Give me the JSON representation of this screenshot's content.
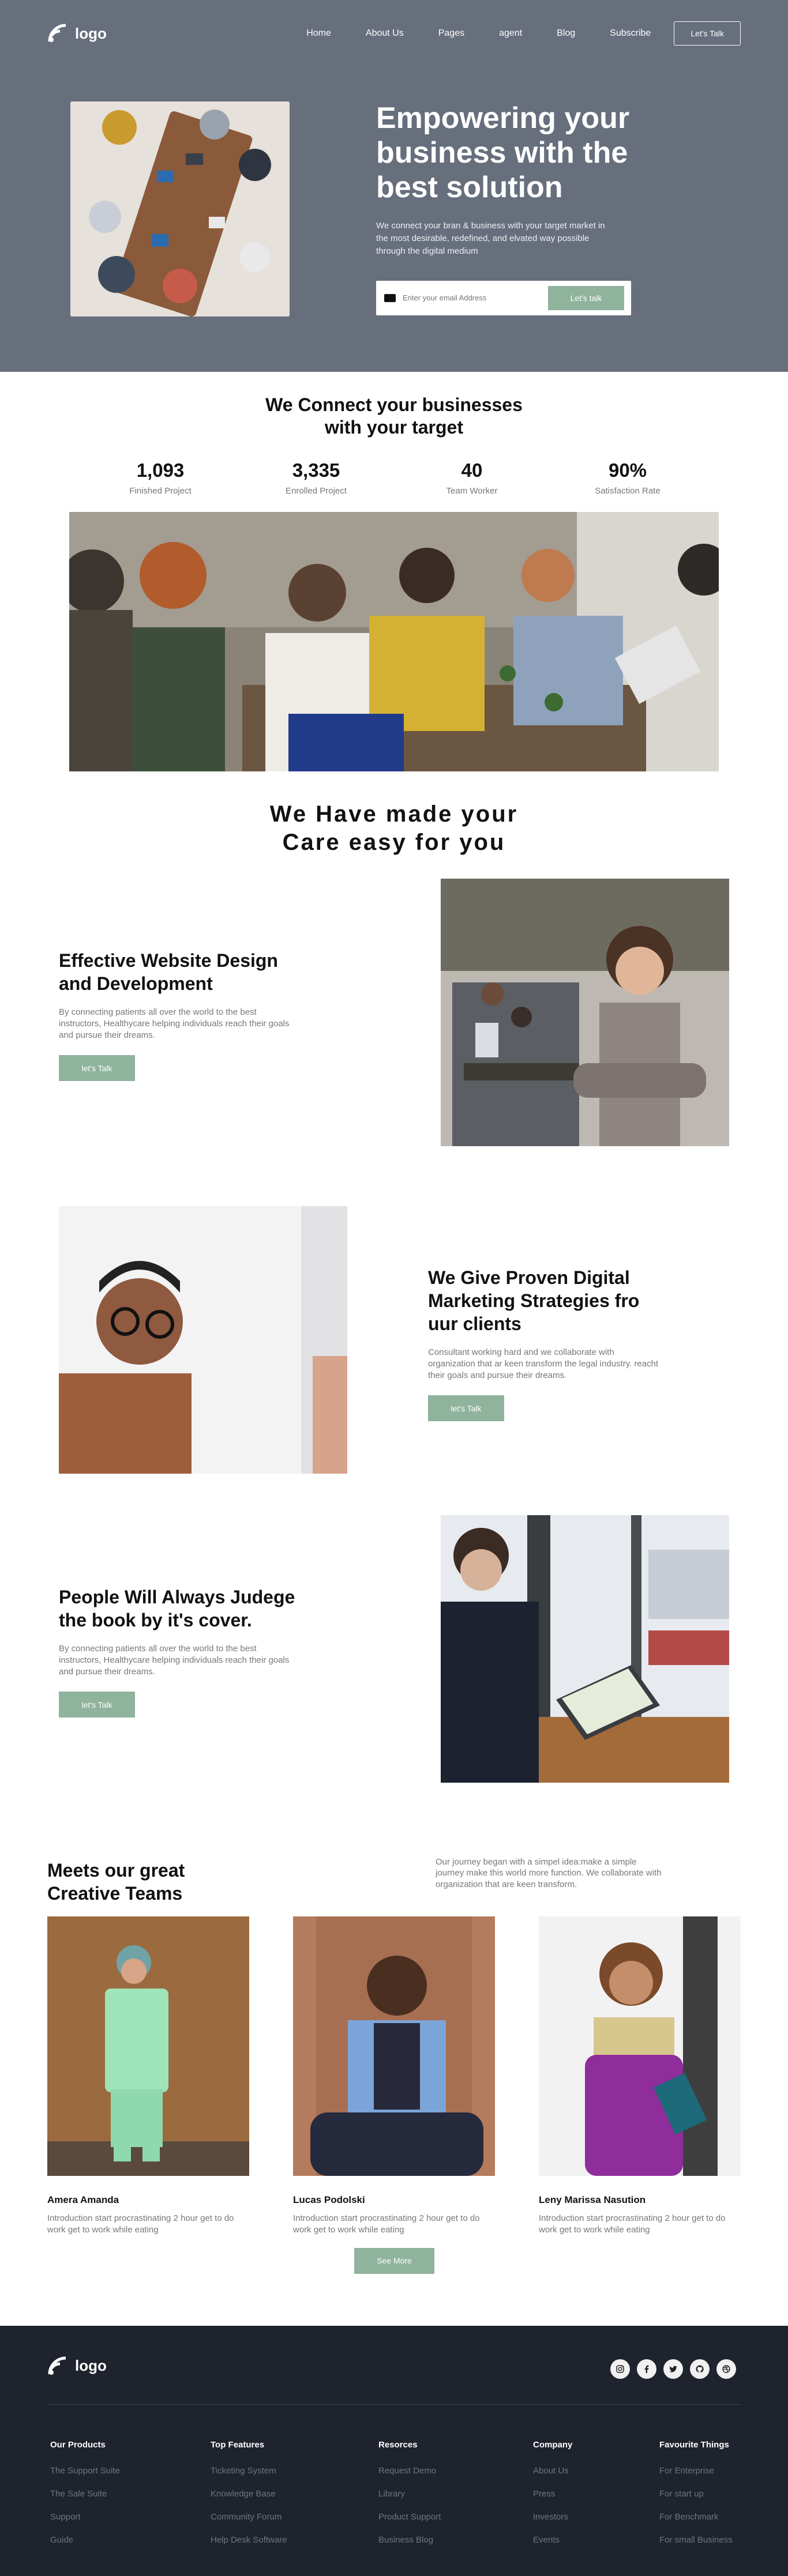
{
  "nav": {
    "logo_text": "logo",
    "links": [
      "Home",
      "About Us",
      "Pages",
      "agent",
      "Blog",
      "Subscribe"
    ],
    "cta": "Let's Talk"
  },
  "hero": {
    "title": "Empowering your business with the best solution",
    "subtitle": "We connect your bran & business with your target market in the most desirable, redefined, and elvated way possible through the digital medium",
    "email_placeholder": "Enter your email Address",
    "button": "Let's talk"
  },
  "connect": {
    "title_line1": "We Connect your businesses",
    "title_line2": "with your target",
    "stats": [
      {
        "value": "1,093",
        "label": "Finished Project"
      },
      {
        "value": "3,335",
        "label": "Enrolled Project"
      },
      {
        "value": "40",
        "label": "Team Worker"
      },
      {
        "value": "90%",
        "label": "Satisfaction Rate"
      }
    ]
  },
  "care": {
    "line1": "We Have made your",
    "line2": "Care easy for you"
  },
  "features": [
    {
      "title": "Effective Website Design and Development",
      "body": "By connecting patients all over the world to the best instructors, Healthycare helping individuals reach their goals and pursue their dreams.",
      "button": "let's Talk"
    },
    {
      "title": "We Give Proven Digital Marketing Strategies fro uur clients",
      "body": "Consultant working hard and we collaborate with organization that ar keen transform the legal industry. reacht their goals and pursue their dreams.",
      "button": "let's Talk"
    },
    {
      "title": "People Will Always Judege the book by it's cover.",
      "body": "By connecting patients all over the world to the best instructors, Healthycare helping individuals reach their goals and pursue their dreams.",
      "button": "let's Talk"
    }
  ],
  "teams": {
    "title": "Meets our great Creative Teams",
    "intro": "Our journey began with a simpel idea:make a simple journey make this world more function. We collaborate with organization that are keen transform.",
    "members": [
      {
        "name": "Amera Amanda",
        "bio": "Introduction start procrastinating 2 hour get to do work get to work while eating"
      },
      {
        "name": "Lucas Podolski",
        "bio": "Introduction start procrastinating 2 hour get to do work get to work while eating"
      },
      {
        "name": "Leny Marissa Nasution",
        "bio": "Introduction start procrastinating 2 hour get to do work get to work while eating"
      }
    ],
    "see_more": "See More"
  },
  "footer": {
    "logo_text": "logo",
    "socials": [
      "instagram-icon",
      "facebook-icon",
      "twitter-icon",
      "github-icon",
      "dribbble-icon"
    ],
    "columns": [
      {
        "title": "Our Products",
        "links": [
          "The Support Suite",
          "The Sale Suite",
          "Support",
          "Guide"
        ]
      },
      {
        "title": "Top Features",
        "links": [
          "Ticketing System",
          "Knowledge Base",
          "Community Forum",
          "Help Desk Software"
        ]
      },
      {
        "title": "Resorces",
        "links": [
          "Request Demo",
          "Library",
          "Product Support",
          "Business Blog"
        ]
      },
      {
        "title": "Company",
        "links": [
          "About Us",
          "Press",
          "Investors",
          "Events"
        ]
      },
      {
        "title": "Favourite Things",
        "links": [
          "For Enterprise",
          "For start up",
          "For Benchmark",
          "For small Business"
        ]
      }
    ]
  },
  "colors": {
    "hero_bg": "#676e7c",
    "accent_green": "#8fb39c",
    "footer_bg": "#1e232d"
  }
}
